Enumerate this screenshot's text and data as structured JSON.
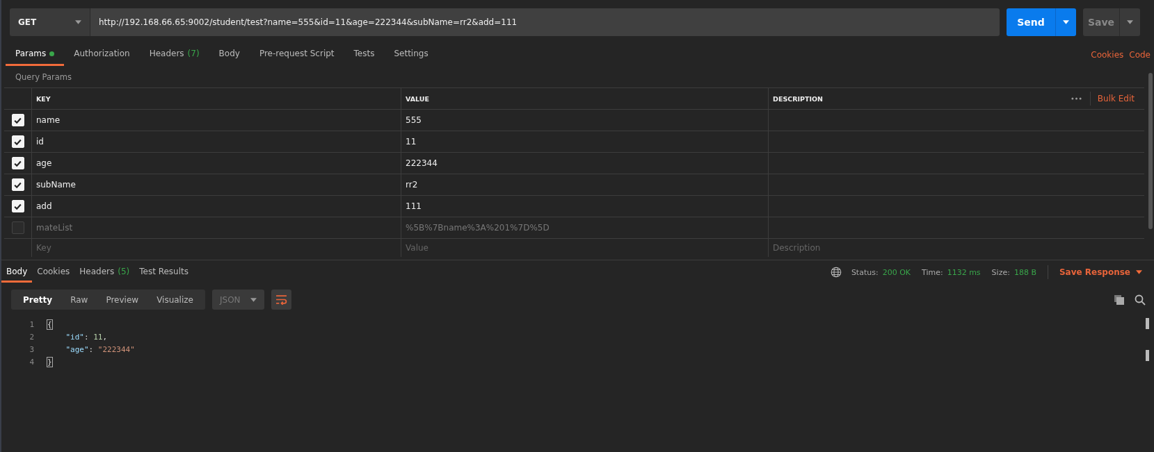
{
  "request": {
    "method": "GET",
    "url": "http://192.168.66.65:9002/student/test?name=555&id=11&age=222344&subName=rr2&add=111",
    "send_label": "Send",
    "save_label": "Save"
  },
  "request_tabs": [
    {
      "label": "Params",
      "dot": true,
      "selected": true
    },
    {
      "label": "Authorization",
      "dot": false,
      "selected": false
    },
    {
      "label": "Headers",
      "count": "(7)",
      "dot": false,
      "selected": false
    },
    {
      "label": "Body",
      "dot": false,
      "selected": false
    },
    {
      "label": "Pre-request Script",
      "dot": false,
      "selected": false
    },
    {
      "label": "Tests",
      "dot": false,
      "selected": false
    },
    {
      "label": "Settings",
      "dot": false,
      "selected": false
    }
  ],
  "request_links": [
    "Cookies",
    "Code"
  ],
  "query_params": {
    "title": "Query Params",
    "columns": [
      "KEY",
      "VALUE",
      "DESCRIPTION"
    ],
    "bulk_edit": "Bulk Edit",
    "rows": [
      {
        "key": "name",
        "value": "555",
        "checked": true
      },
      {
        "key": "id",
        "value": "11",
        "checked": true
      },
      {
        "key": "age",
        "value": "222344",
        "checked": true
      },
      {
        "key": "subName",
        "value": "rr2",
        "checked": true
      },
      {
        "key": "add",
        "value": "111",
        "checked": true
      },
      {
        "key": "mateList",
        "value": "%5B%7Bname%3A%201%7D%5D",
        "checked": false
      }
    ],
    "new_row": {
      "key": {
        "placeholder": "Key"
      },
      "value": {
        "placeholder": "Value"
      },
      "description": {
        "placeholder": "Description"
      }
    }
  },
  "response_tabs": [
    {
      "label": "Body",
      "selected": true
    },
    {
      "label": "Cookies",
      "selected": false
    },
    {
      "label": "Headers",
      "count": "(5)",
      "selected": false
    },
    {
      "label": "Test Results",
      "selected": false
    }
  ],
  "response_meta": [
    {
      "label": "Status:",
      "value": "200 OK"
    },
    {
      "label": "Time:",
      "value": "1132 ms"
    },
    {
      "label": "Size:",
      "value": "188 B"
    }
  ],
  "save_response": "Save Response",
  "view_modes": [
    {
      "label": "Pretty",
      "selected": true
    },
    {
      "label": "Raw",
      "selected": false
    },
    {
      "label": "Preview",
      "selected": false
    },
    {
      "label": "Visualize",
      "selected": false
    }
  ],
  "format": "JSON",
  "code": [
    {
      "number": "1",
      "tokens": [
        {
          "kind": "brace",
          "text": "{"
        }
      ]
    },
    {
      "number": "2",
      "tokens": [
        {
          "kind": "key",
          "text": "    \"id\""
        },
        {
          "kind": "punct",
          "text": ": "
        },
        {
          "kind": "number",
          "text": "11"
        },
        {
          "kind": "punct",
          "text": ","
        }
      ]
    },
    {
      "number": "3",
      "tokens": [
        {
          "kind": "key",
          "text": "    \"age\""
        },
        {
          "kind": "punct",
          "text": ": "
        },
        {
          "kind": "string",
          "text": "\"222344\""
        }
      ]
    },
    {
      "number": "4",
      "tokens": [
        {
          "kind": "brace",
          "text": "}"
        }
      ]
    }
  ]
}
